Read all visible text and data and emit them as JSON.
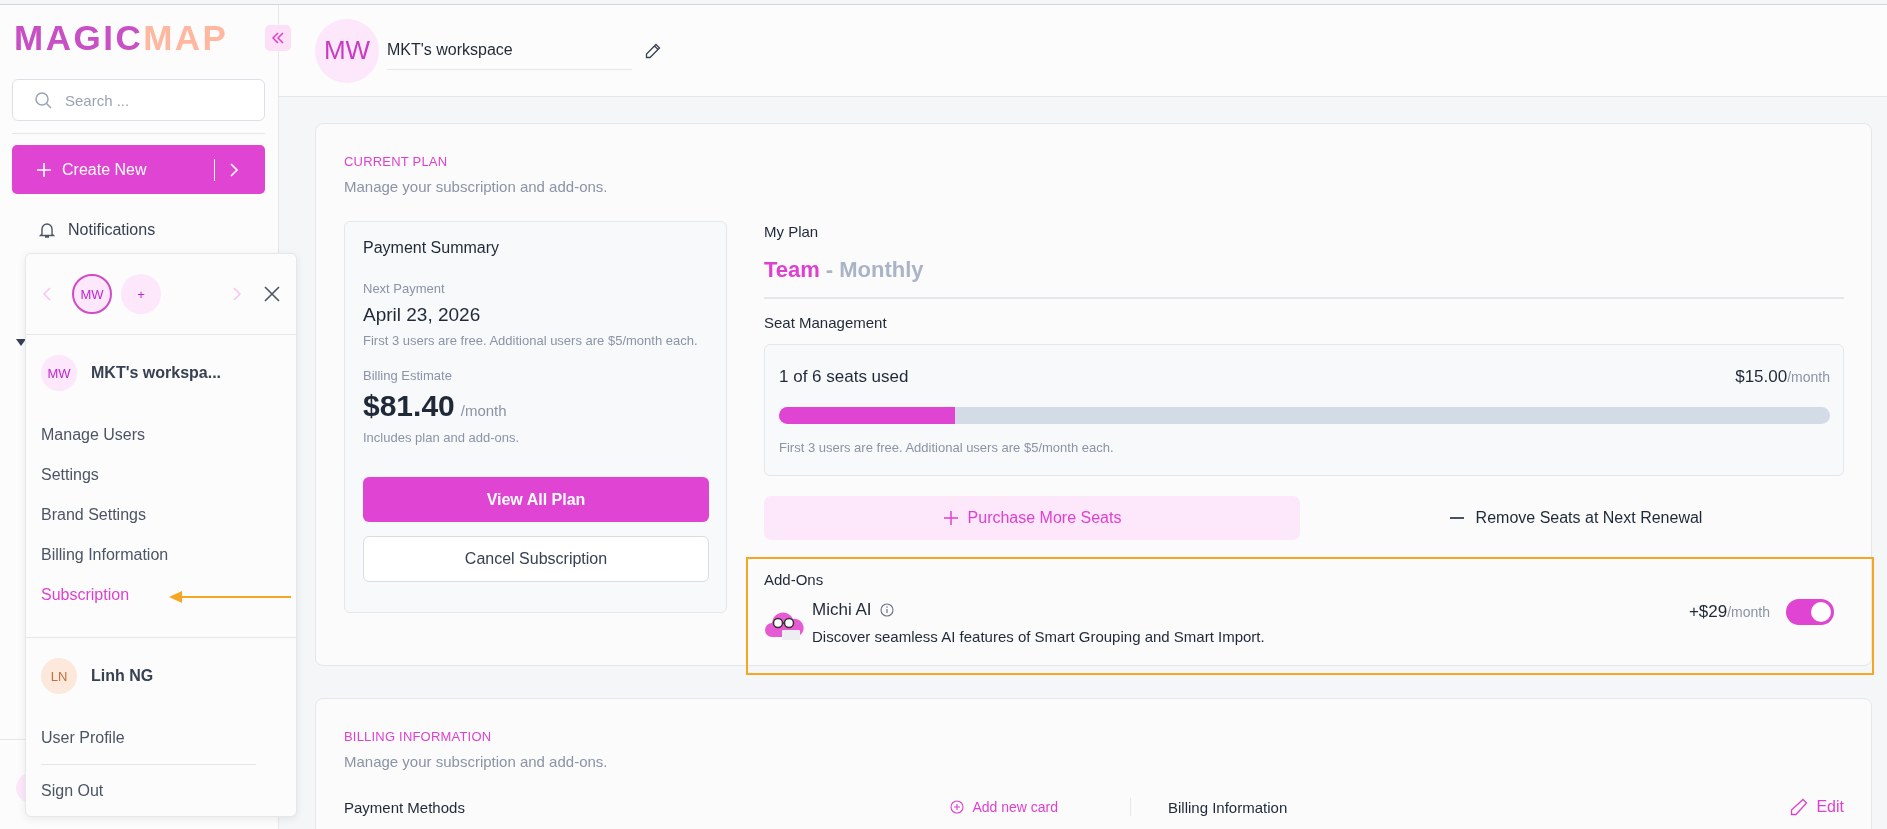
{
  "sidebar": {
    "logo": [
      "MAGIC",
      "MAP"
    ],
    "search": {
      "placeholder": "Search ..."
    },
    "create_button": "Create New",
    "nav_items": [
      {
        "label": "Notifications"
      }
    ]
  },
  "account_menu": {
    "workspaces": [
      {
        "initials": "MW",
        "selected": true
      }
    ],
    "add_workspace": "+",
    "current_workspace": {
      "initials": "MW",
      "name": "MKT's workspa..."
    },
    "items": [
      {
        "label": "Manage Users",
        "selected": false
      },
      {
        "label": "Settings",
        "selected": false
      },
      {
        "label": "Brand Settings",
        "selected": false
      },
      {
        "label": "Billing Information",
        "selected": false
      },
      {
        "label": "Subscription",
        "selected": true
      }
    ],
    "user": {
      "initials": "LN",
      "name": "Linh NG"
    },
    "user_items": [
      "User Profile",
      "Sign Out"
    ]
  },
  "header": {
    "initials": "MW",
    "workspace_name": "MKT's workspace"
  },
  "current_plan": {
    "title": "CURRENT PLAN",
    "subtitle": "Manage your subscription and add-ons.",
    "payment_summary": {
      "title": "Payment Summary",
      "next_payment_label": "Next Payment",
      "next_payment": "April 23, 2026",
      "note": "First 3 users are free. Additional users are $5/month each.",
      "estimate_label": "Billing Estimate",
      "estimate": "$81.40",
      "estimate_unit": "/month",
      "estimate_note": "Includes plan and add-ons.",
      "primary_button": "View All Plan",
      "secondary_button": "Cancel Subscription"
    },
    "my_plan": {
      "label": "My Plan",
      "plan": "Team",
      "cycle": "- Monthly"
    },
    "seats": {
      "label": "Seat Management",
      "usage": "1 of 6 seats used",
      "price": "$15.00",
      "unit": "/month",
      "level": 0.167,
      "note": "First 3 users are free. Additional users are $5/month each.",
      "purchase_button": "Purchase More Seats",
      "remove_button": "Remove Seats at Next Renewal"
    },
    "add_ons": {
      "title": "Add-Ons",
      "items": [
        {
          "name": "Michi AI",
          "description": "Discover seamless AI features of Smart Grouping and Smart Import.",
          "price": "+$29",
          "unit": "/month",
          "on": true
        }
      ]
    }
  },
  "billing_information": {
    "title": "BILLING INFORMATION",
    "subtitle": "Manage your subscription and add-ons.",
    "payment_methods": "Payment Methods",
    "add_card": "Add new card",
    "billing_info": "Billing Information",
    "edit": "Edit"
  }
}
